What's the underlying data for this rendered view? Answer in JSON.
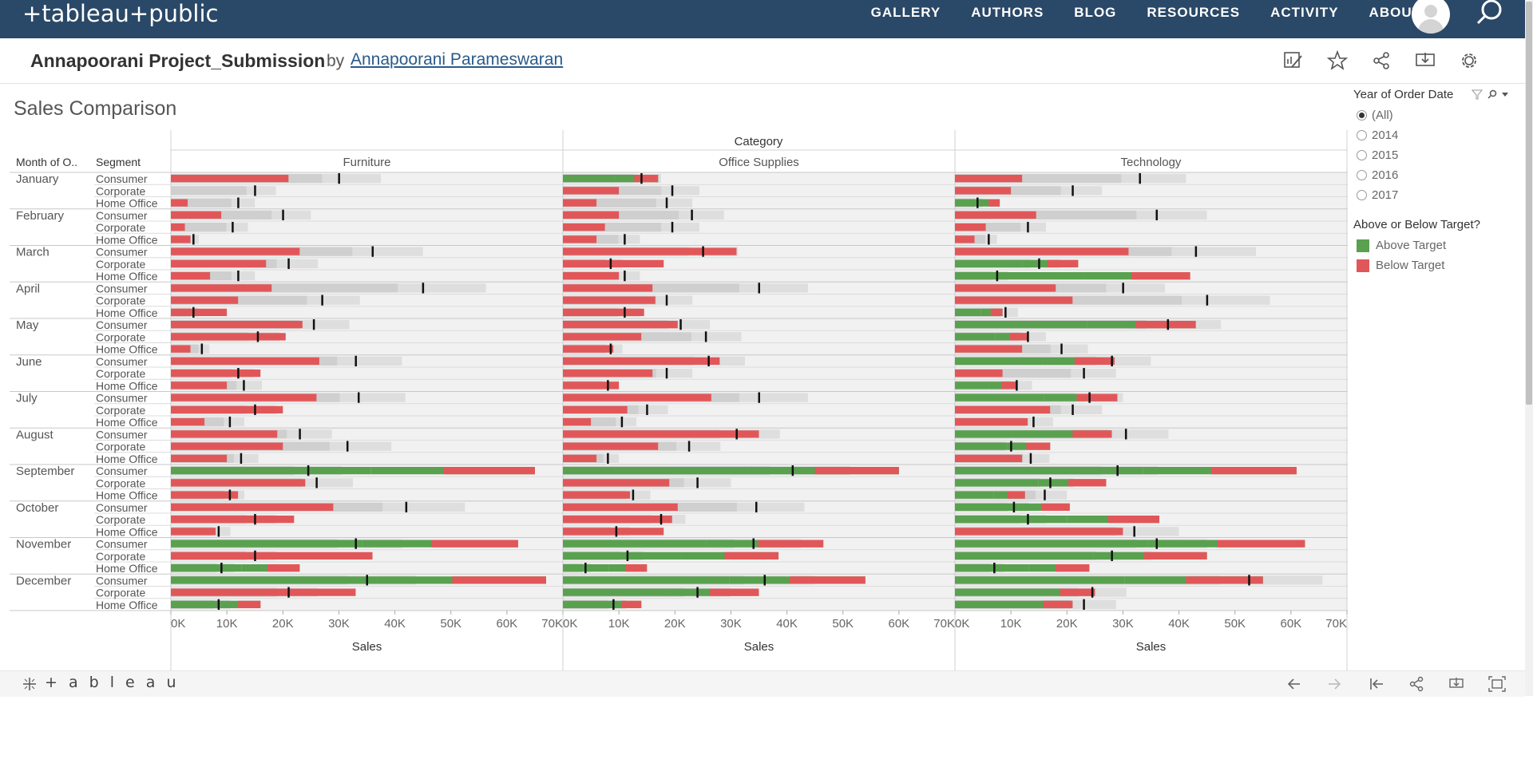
{
  "nav": {
    "brand": "+tableau+public",
    "links": [
      "GALLERY",
      "AUTHORS",
      "BLOG",
      "RESOURCES",
      "ACTIVITY",
      "ABOUT"
    ]
  },
  "viz": {
    "title": "Annapoorani Project_Submission",
    "by": "by",
    "author": "Annapoorani Parameswaran"
  },
  "sheet": {
    "title": "Sales Comparison"
  },
  "filter": {
    "title": "Year of Order Date",
    "options": [
      "(All)",
      "2014",
      "2015",
      "2016",
      "2017"
    ],
    "selected": "(All)"
  },
  "legend": {
    "title": "Above or Below Target?",
    "items": [
      {
        "label": "Above Target",
        "color": "#59a14f"
      },
      {
        "label": "Below Target",
        "color": "#e15759"
      }
    ]
  },
  "colors": {
    "nav_bg": "#2a4867",
    "above": "#59a14f",
    "below": "#e15759",
    "band_light": "#dedede",
    "band_mid": "#cfcfcf"
  },
  "bottombar": {
    "logo": "+ a b l e a u"
  },
  "chart_data": {
    "type": "bar",
    "title": "Sales Comparison",
    "column_header": "Category",
    "row_headers": [
      "Month of O..",
      "Segment"
    ],
    "categories": [
      "Furniture",
      "Office Supplies",
      "Technology"
    ],
    "months": [
      "January",
      "February",
      "March",
      "April",
      "May",
      "June",
      "July",
      "August",
      "September",
      "October",
      "November",
      "December"
    ],
    "segments": [
      "Consumer",
      "Corporate",
      "Home Office"
    ],
    "xlabel": "Sales",
    "xlim": [
      0,
      70000
    ],
    "ticks": [
      "0K",
      "10K",
      "20K",
      "30K",
      "40K",
      "50K",
      "60K",
      "70K"
    ],
    "series": [
      {
        "name": "Furniture",
        "sales": [
          [
            21,
            0,
            3
          ],
          [
            9,
            2.5,
            3.5
          ],
          [
            23,
            17,
            7
          ],
          [
            18,
            12,
            10
          ],
          [
            23.5,
            20.5,
            3.5
          ],
          [
            26.5,
            16,
            10
          ],
          [
            26,
            20,
            6
          ],
          [
            19,
            20,
            10
          ],
          [
            65,
            24,
            12
          ],
          [
            29,
            22,
            8
          ],
          [
            62,
            36,
            23
          ],
          [
            67,
            33,
            16
          ]
        ],
        "targets": [
          [
            30,
            15,
            12
          ],
          [
            20,
            11,
            4
          ],
          [
            36,
            21,
            12
          ],
          [
            45,
            27,
            4
          ],
          [
            25.5,
            15.5,
            5.5
          ],
          [
            33,
            12,
            13
          ],
          [
            33.5,
            15,
            10.5
          ],
          [
            23,
            31.5,
            12.5
          ],
          [
            24.5,
            26,
            10.5
          ],
          [
            42,
            15,
            8.5
          ],
          [
            33,
            15,
            9
          ],
          [
            35,
            21,
            8.5
          ]
        ],
        "above": [
          [
            0,
            0,
            0
          ],
          [
            0,
            0,
            0
          ],
          [
            0,
            0,
            0
          ],
          [
            0,
            0,
            0
          ],
          [
            0,
            0,
            0
          ],
          [
            0,
            0,
            0
          ],
          [
            0,
            0,
            0
          ],
          [
            0,
            0,
            0
          ],
          [
            1,
            0,
            0
          ],
          [
            0,
            0,
            0
          ],
          [
            1,
            0,
            1
          ],
          [
            1,
            0,
            1
          ]
        ]
      },
      {
        "name": "Office Supplies",
        "sales": [
          [
            17,
            10,
            6
          ],
          [
            10,
            7.5,
            6
          ],
          [
            31,
            18,
            10
          ],
          [
            16,
            16.5,
            14.5
          ],
          [
            20.5,
            14,
            9
          ],
          [
            28,
            16,
            10
          ],
          [
            26.5,
            11.5,
            5
          ],
          [
            35,
            17,
            6
          ],
          [
            60,
            19,
            12
          ],
          [
            20.5,
            19.5,
            18
          ],
          [
            46.5,
            38.5,
            15
          ],
          [
            54,
            35,
            14
          ]
        ],
        "targets": [
          [
            14,
            19.5,
            18.5
          ],
          [
            23,
            19.5,
            11
          ],
          [
            25,
            8.5,
            11
          ],
          [
            35,
            18.5,
            11
          ],
          [
            21,
            25.5,
            8.5
          ],
          [
            26,
            18.5,
            8
          ],
          [
            35,
            15,
            10.5
          ],
          [
            31,
            22.5,
            8
          ],
          [
            41,
            24,
            12.5
          ],
          [
            34.5,
            17.5,
            9.5
          ],
          [
            34,
            11.5,
            4
          ],
          [
            36,
            24,
            9
          ]
        ],
        "above": [
          [
            1,
            0,
            0
          ],
          [
            0,
            0,
            0
          ],
          [
            0,
            0,
            0
          ],
          [
            0,
            0,
            0
          ],
          [
            0,
            0,
            0
          ],
          [
            0,
            0,
            0
          ],
          [
            0,
            0,
            0
          ],
          [
            0,
            0,
            0
          ],
          [
            1,
            0,
            0
          ],
          [
            0,
            0,
            0
          ],
          [
            1,
            1,
            1
          ],
          [
            1,
            1,
            1
          ]
        ]
      },
      {
        "name": "Technology",
        "sales": [
          [
            12,
            10,
            8
          ],
          [
            14.5,
            5.5,
            3.5
          ],
          [
            31,
            22,
            42
          ],
          [
            18,
            21,
            8.5
          ],
          [
            43,
            13,
            12
          ],
          [
            28.5,
            8.5,
            11
          ],
          [
            29,
            17,
            13
          ],
          [
            28,
            17,
            12
          ],
          [
            61,
            27,
            12.5
          ],
          [
            20.5,
            36.5,
            30
          ],
          [
            62.5,
            45,
            24
          ],
          [
            55,
            25,
            21
          ]
        ],
        "targets": [
          [
            33,
            21,
            4
          ],
          [
            36,
            13,
            6
          ],
          [
            43,
            15,
            7.5
          ],
          [
            30,
            45,
            9
          ],
          [
            38,
            13,
            19
          ],
          [
            28,
            23,
            11
          ],
          [
            24,
            21,
            14
          ],
          [
            30.5,
            10,
            13.5
          ],
          [
            29,
            17,
            16
          ],
          [
            10.5,
            13,
            32
          ],
          [
            36,
            28,
            7
          ],
          [
            52.5,
            24.5,
            23
          ]
        ],
        "above": [
          [
            0,
            0,
            1
          ],
          [
            0,
            0,
            0
          ],
          [
            0,
            1,
            1
          ],
          [
            0,
            0,
            1
          ],
          [
            1,
            1,
            0
          ],
          [
            1,
            0,
            1
          ],
          [
            1,
            0,
            0
          ],
          [
            1,
            1,
            0
          ],
          [
            1,
            1,
            1
          ],
          [
            1,
            1,
            0
          ],
          [
            1,
            1,
            1
          ],
          [
            1,
            1,
            1
          ]
        ]
      }
    ],
    "units": "thousands of USD"
  }
}
